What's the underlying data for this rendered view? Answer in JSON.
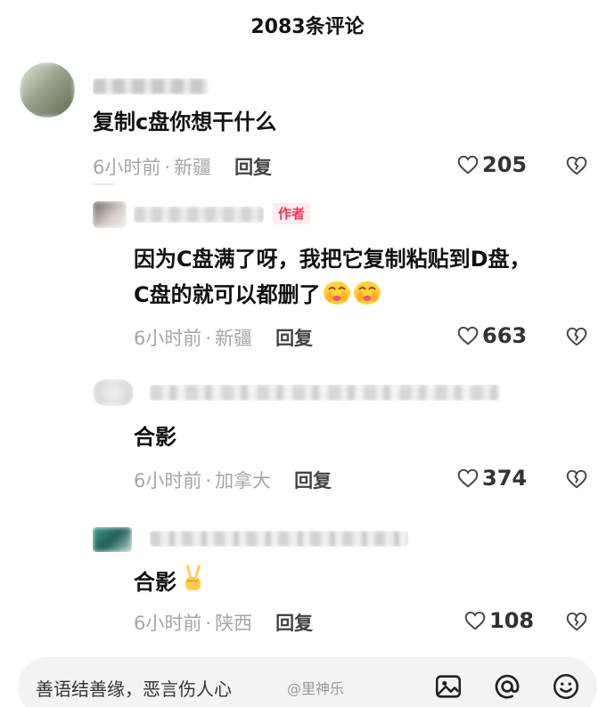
{
  "header": {
    "title": "2083条评论"
  },
  "comments": [
    {
      "text": "复制c盘你想干什么",
      "time": "6小时前",
      "location": "新疆",
      "reply_label": "回复",
      "likes": "205"
    },
    {
      "author_tag": "作者",
      "text_line1": "因为C盘满了呀，我把它复制粘贴到D盘，",
      "text_line2": "C盘的就可以都删了",
      "time": "6小时前",
      "location": "新疆",
      "reply_label": "回复",
      "likes": "663"
    },
    {
      "text": "合影",
      "time": "6小时前",
      "location": "加拿大",
      "reply_label": "回复",
      "likes": "374"
    },
    {
      "text": "合影",
      "time": "6小时前",
      "location": "陕西",
      "reply_label": "回复",
      "likes": "108"
    }
  ],
  "input": {
    "placeholder": "善语结善缘，恶言伤人心",
    "watermark": "@里神乐"
  },
  "icons": {
    "like": "heart-outline-icon",
    "dislike": "broken-heart-icon",
    "image": "image-icon",
    "mention": "at-sign-icon",
    "emoji": "smiley-icon"
  },
  "colors": {
    "author_tag": "#f2375a",
    "meta": "#a6a6a6"
  }
}
